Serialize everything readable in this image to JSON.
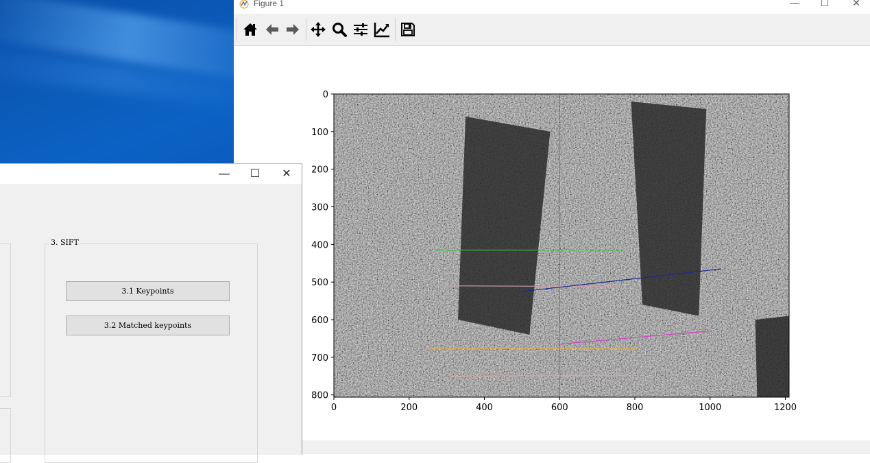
{
  "figure_window": {
    "title": "Figure 1",
    "controls": {
      "minimize": "—",
      "maximize": "☐",
      "close": "✕"
    },
    "toolbar": [
      "home-icon",
      "back-arrow-icon",
      "forward-arrow-icon",
      "pan-move-icon",
      "zoom-magnifier-icon",
      "configure-subplots-icon",
      "edit-axes-curves-icon",
      "save-floppy-icon"
    ]
  },
  "chart_data": {
    "type": "image",
    "title": "",
    "xlabel": "",
    "ylabel": "",
    "xlim": [
      0,
      1210
    ],
    "ylim": [
      806,
      0
    ],
    "xticks": [
      0,
      200,
      400,
      600,
      800,
      1000,
      1200
    ],
    "yticks": [
      0,
      100,
      200,
      300,
      400,
      500,
      600,
      700,
      800
    ],
    "xtick_labels": [
      "0",
      "200",
      "400",
      "600",
      "800",
      "1000",
      "1200"
    ],
    "ytick_labels": [
      "0",
      "100",
      "200",
      "300",
      "400",
      "500",
      "600",
      "700",
      "800"
    ],
    "image_content": "two grayscale aerial city views side by side with colored keypoint match lines",
    "match_lines": [
      {
        "x1": 270,
        "y1": 415,
        "x2": 770,
        "y2": 415,
        "color": "#33cc33"
      },
      {
        "x1": 290,
        "y1": 510,
        "x2": 760,
        "y2": 512,
        "color": "#c8a0b0"
      },
      {
        "x1": 500,
        "y1": 525,
        "x2": 1030,
        "y2": 465,
        "color": "#1a2a8c"
      },
      {
        "x1": 600,
        "y1": 665,
        "x2": 1000,
        "y2": 630,
        "color": "#d040c8"
      },
      {
        "x1": 250,
        "y1": 676,
        "x2": 810,
        "y2": 676,
        "color": "#e8b040"
      },
      {
        "x1": 310,
        "y1": 750,
        "x2": 800,
        "y2": 748,
        "color": "#e0a0a0"
      }
    ]
  },
  "dialog": {
    "controls": {
      "minimize": "—",
      "maximize": "☐",
      "close": "✕"
    },
    "group_title": "3. SIFT",
    "buttons": {
      "keypoints": "3.1 Keypoints",
      "matched": "3.2 Matched keypoints"
    }
  }
}
